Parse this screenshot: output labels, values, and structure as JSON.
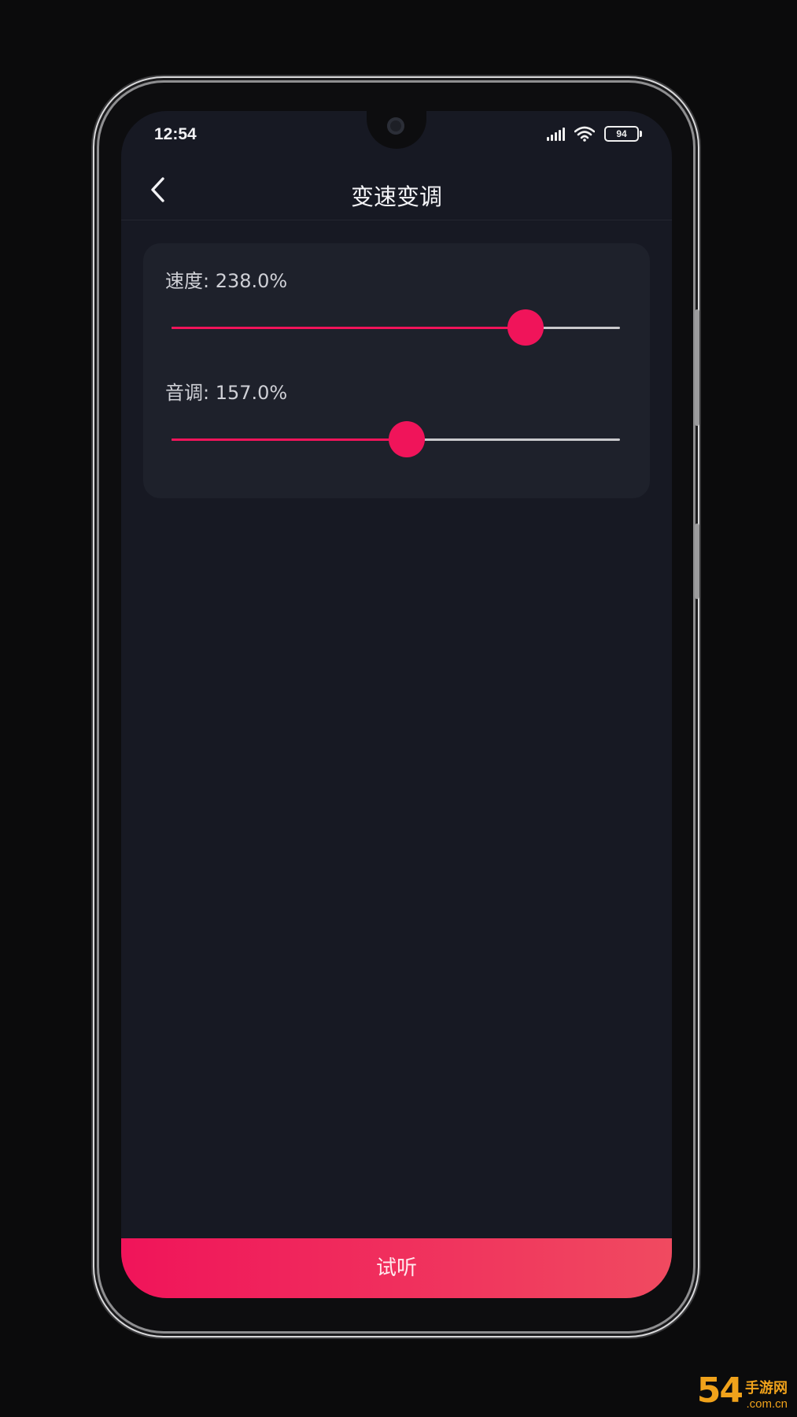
{
  "status_bar": {
    "time": "12:54",
    "battery": "94",
    "icons": [
      "signal-icon",
      "wifi-icon",
      "battery-icon"
    ]
  },
  "header": {
    "title": "变速变调",
    "back_icon": "chevron-left-icon"
  },
  "sliders": [
    {
      "label": "速度: 238.0%",
      "level_fraction": 0.79
    },
    {
      "label": "音调: 157.0%",
      "level_fraction": 0.525
    }
  ],
  "footer": {
    "button_label": "试听"
  },
  "watermark": {
    "logo": "54",
    "line1": "手游网",
    "line2": ".com.cn"
  },
  "colors": {
    "accent": "#f0145a",
    "accent_end": "#f04a60",
    "background": "#171923",
    "card": "#1e212b"
  }
}
